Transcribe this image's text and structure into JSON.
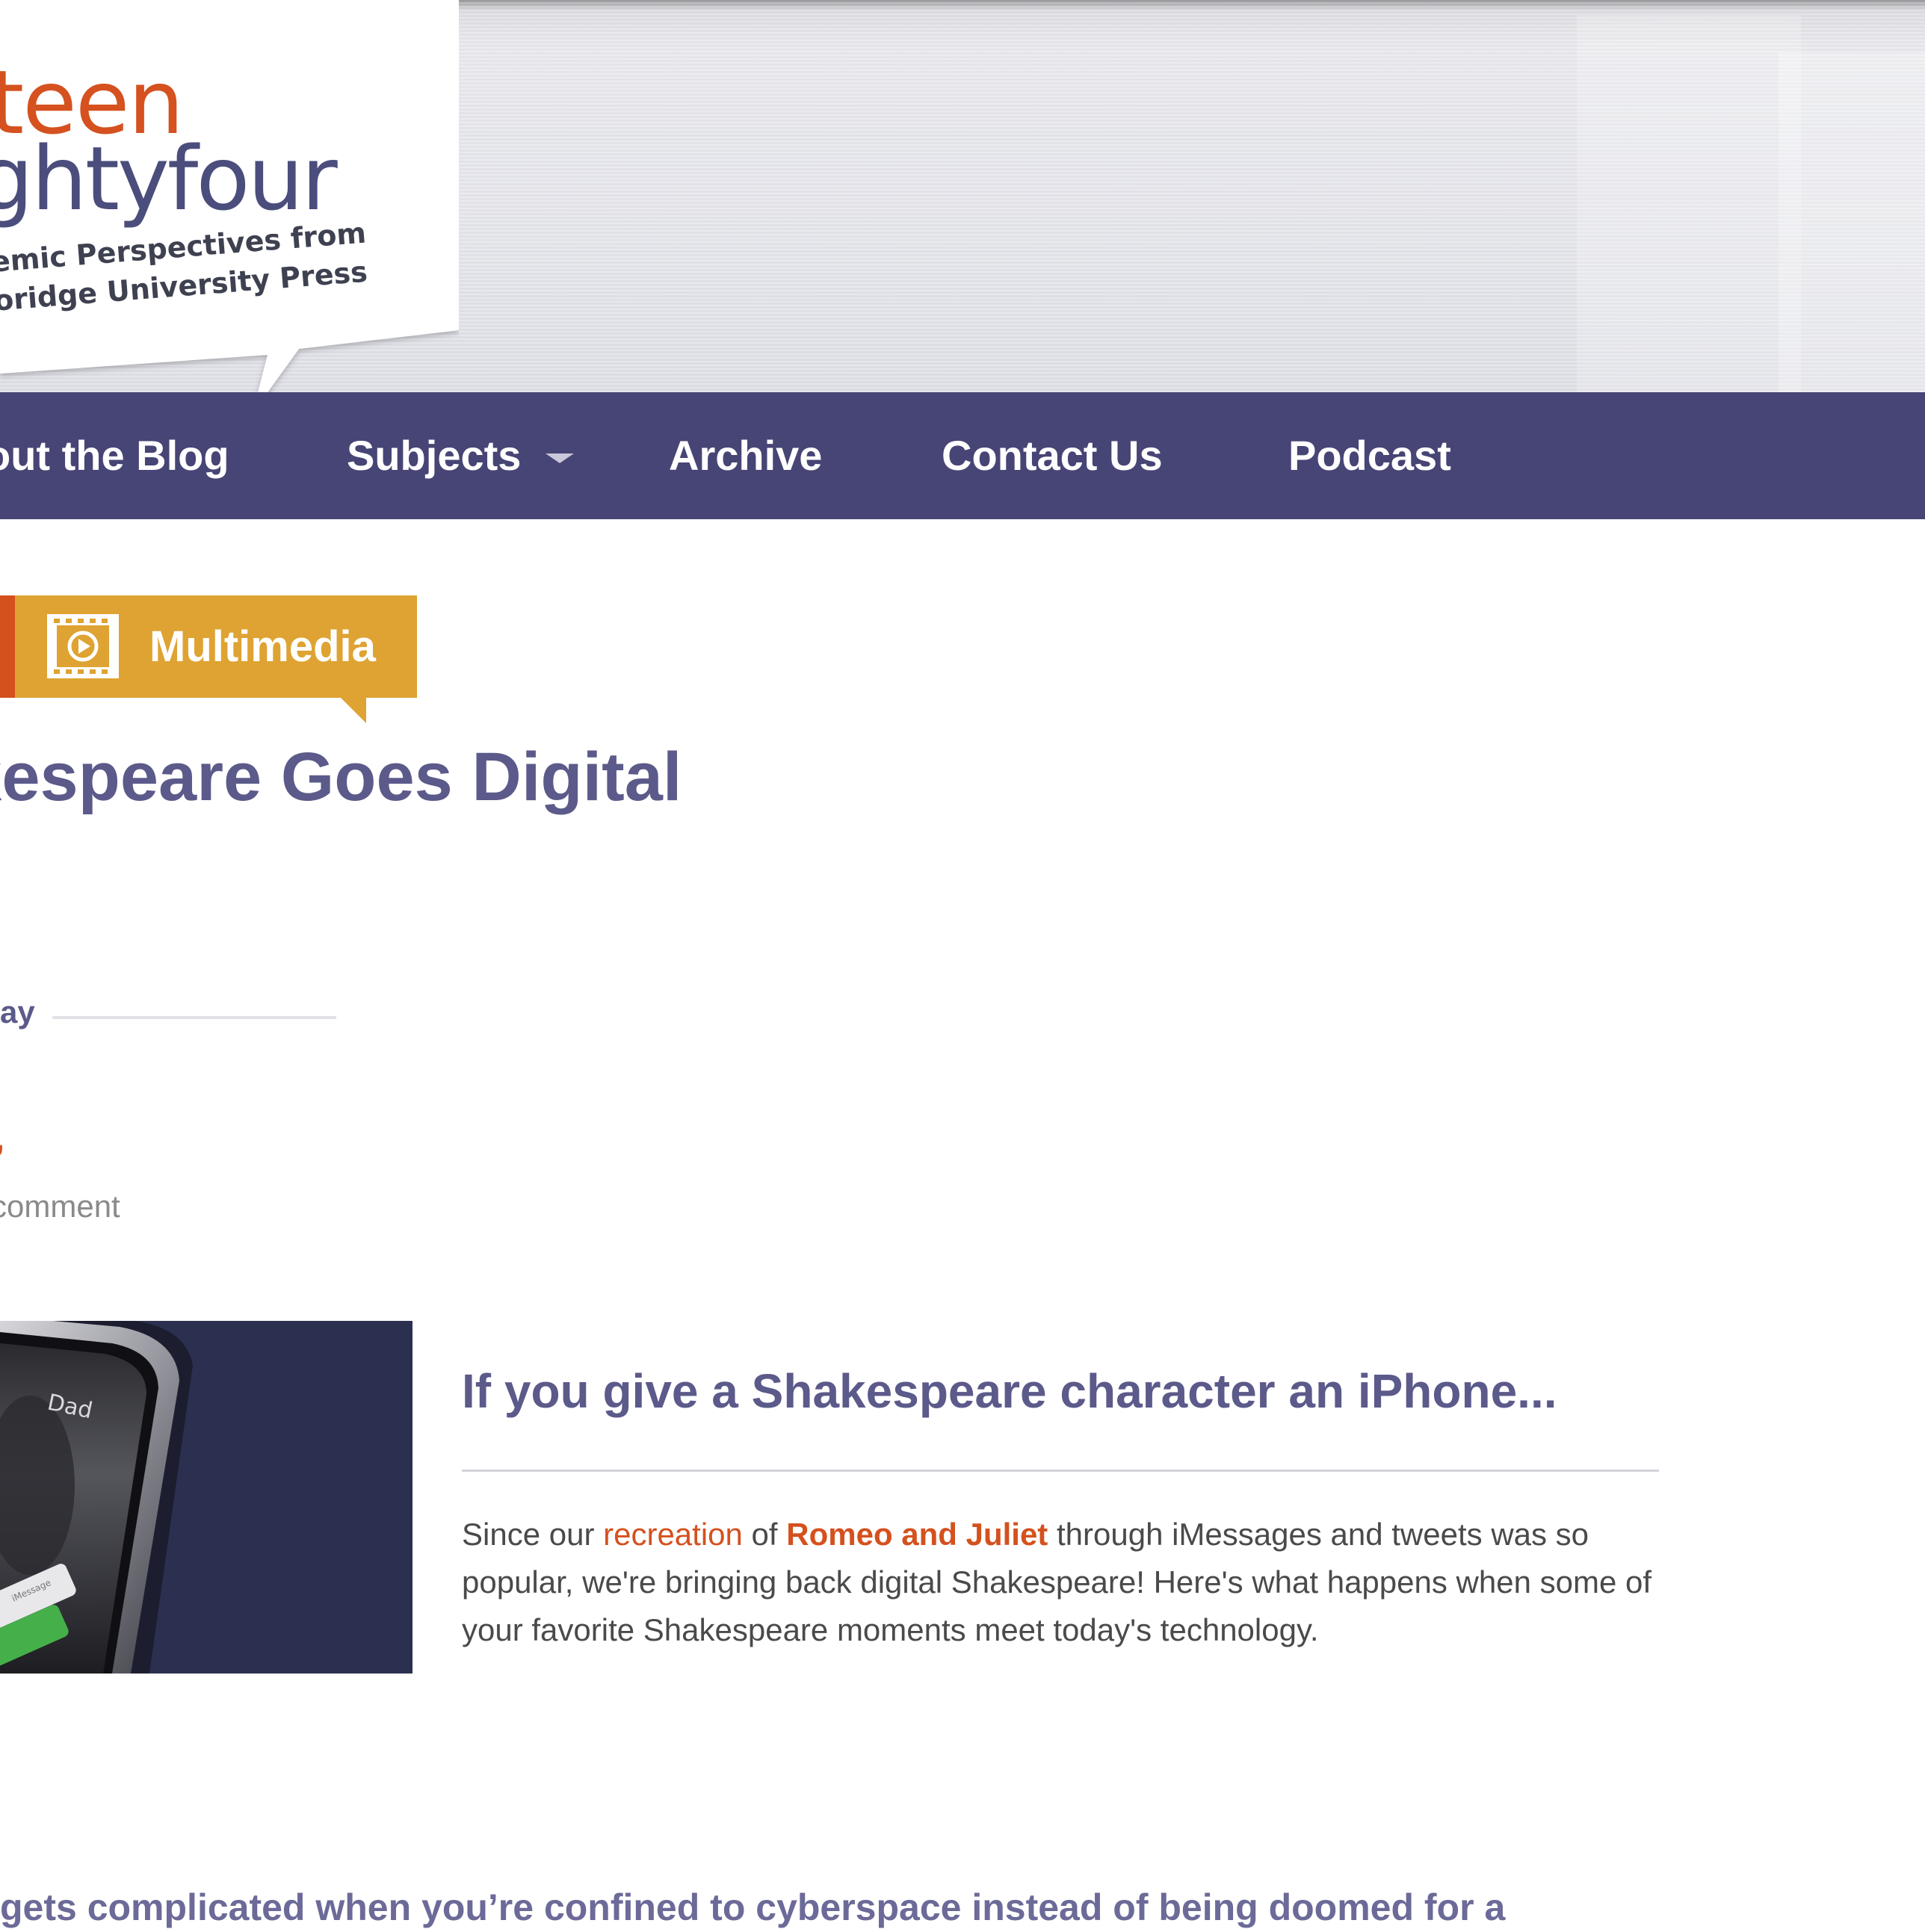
{
  "logo": {
    "line1": "teen",
    "line2": "ghtyfour",
    "tagline_line1": "emic Perspectives from",
    "tagline_line2": "oridge University Press"
  },
  "nav": {
    "items": [
      {
        "label": "out the Blog"
      },
      {
        "label": "Subjects",
        "has_dropdown": true
      },
      {
        "label": "Archive"
      },
      {
        "label": "Contact Us"
      },
      {
        "label": "Podcast"
      }
    ],
    "caret_icon": "chevron-down-icon"
  },
  "category": {
    "label": "Multimedia",
    "icon": "film-play-icon"
  },
  "post": {
    "title": "akespeare Goes Digital",
    "author_fragment": "ay",
    "date_fragment": ",",
    "comment_link": "comment"
  },
  "feature": {
    "image_text_contact": "Dad",
    "image_text_message": "iMessage",
    "heading": "If you give a Shakespeare character an iPhone...",
    "text_before": "Since our ",
    "link_recreation": "recreation",
    "text_of": " of ",
    "link_romeo": "Romeo and Juliet",
    "text_after": " through iMessages and tweets was so popular, we're bringing back digital Shakespeare! Here's what happens when some of your favorite Shakespeare moments meet today's technology."
  },
  "body": {
    "cutoff_line": "gets complicated when you’re confined to cyberspace instead of being doomed for a"
  },
  "colors": {
    "nav_bg": "#474575",
    "accent_orange": "#d4511e",
    "tag_gold": "#dea332",
    "title_purple": "#5b5a8a"
  }
}
